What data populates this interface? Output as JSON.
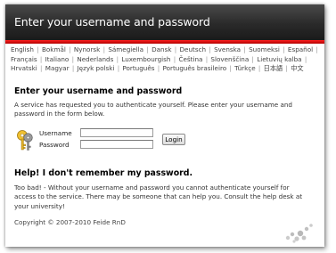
{
  "header": {
    "title": "Enter your username and password"
  },
  "languages": [
    "English",
    "Bokmål",
    "Nynorsk",
    "Sámegiella",
    "Dansk",
    "Deutsch",
    "Svenska",
    "Suomeksi",
    "Español",
    "Français",
    "Italiano",
    "Nederlands",
    "Luxembourgish",
    "Čeština",
    "Slovenščina",
    "Lietuvių kalba",
    "Hrvatski",
    "Magyar",
    "Język polski",
    "Português",
    "Português brasileiro",
    "Türkçe",
    "日本語",
    "中文"
  ],
  "login": {
    "heading": "Enter your username and password",
    "intro": "A service has requested you to authenticate yourself. Please enter your username and password in the form below.",
    "username_label": "Username",
    "password_label": "Password",
    "button_label": "Login"
  },
  "help": {
    "heading": "Help! I don't remember my password.",
    "text": "Too bad! - Without your username and password you cannot authenticate yourself for access to the service. There may be someone that can help you. Consult the help desk at your university!"
  },
  "footer": {
    "copyright": "Copyright © 2007-2010 ",
    "link": "Feide RnD"
  },
  "icons": [
    "key-icon",
    "logo-icon"
  ],
  "colors": {
    "accent": "#cc0000",
    "header_bg": "#2a2a2a"
  }
}
